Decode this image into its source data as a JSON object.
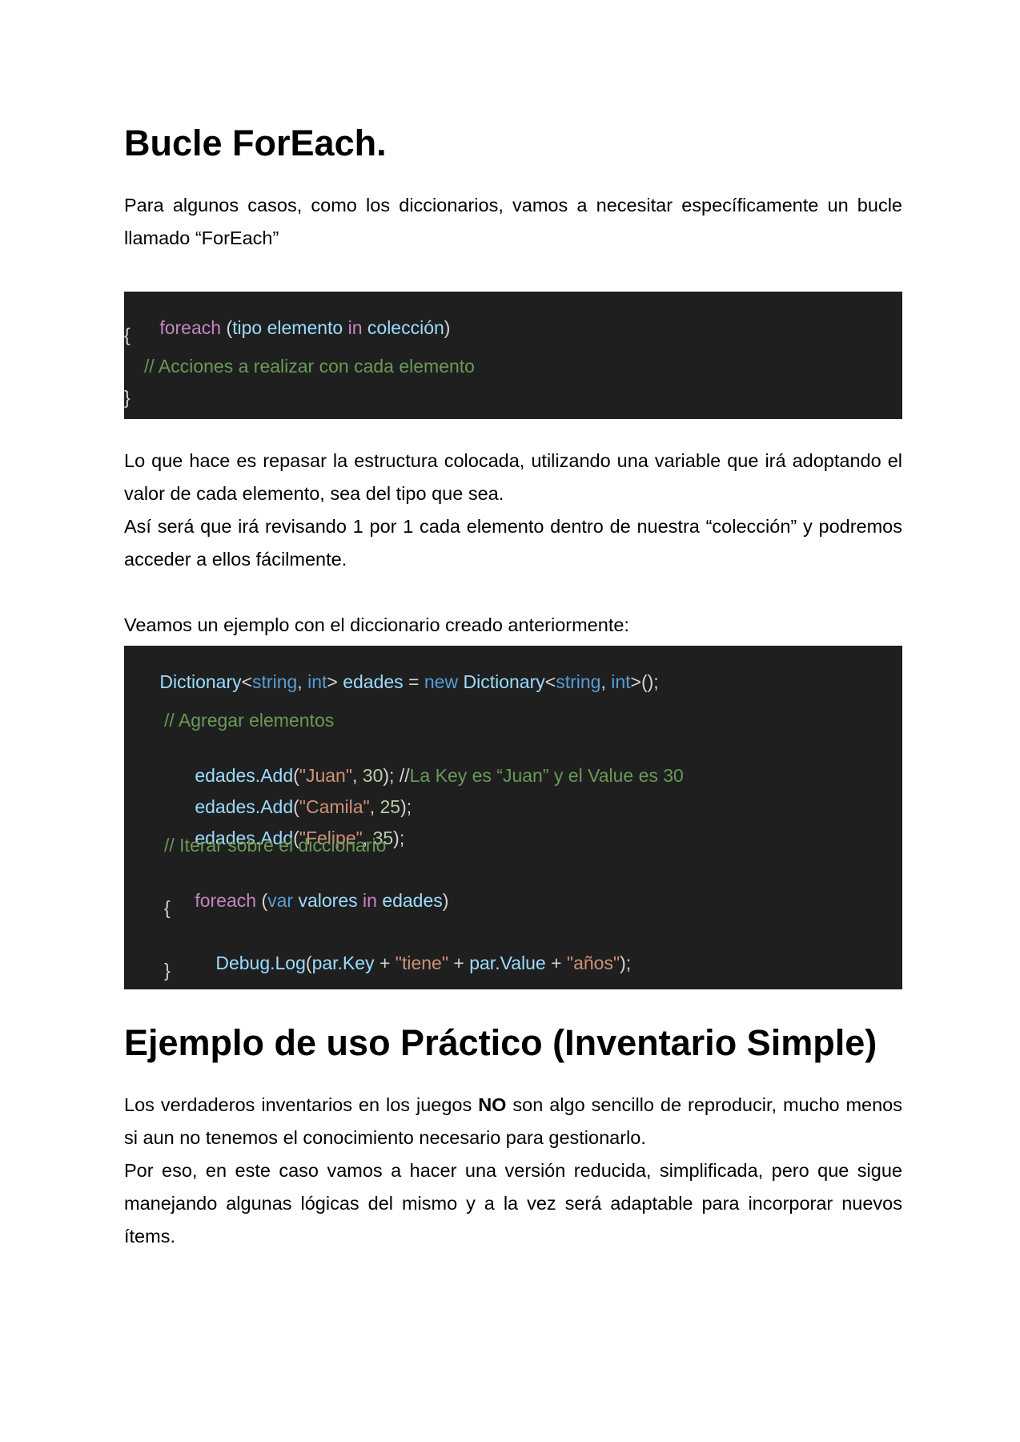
{
  "section1": {
    "heading": "Bucle ForEach.",
    "intro": "Para algunos casos, como los diccionarios, vamos a necesitar específicamente un bucle llamado “ForEach”",
    "code1": {
      "line1": {
        "t1": "foreach",
        "t2": " (",
        "t3": "tipo elemento",
        "t4": " in ",
        "t5": "colección",
        "t6": ")"
      },
      "line2": "{",
      "line3": "// Acciones a realizar con cada elemento",
      "line4": "}"
    },
    "explanation1": "Lo que hace es repasar la estructura colocada, utilizando una variable que irá adoptando el valor de cada elemento, sea del tipo que sea.",
    "explanation2": "Así será que irá revisando 1 por 1 cada elemento dentro de nuestra “colección” y podremos acceder a ellos fácilmente.",
    "example_intro": "Veamos un ejemplo con el diccionario creado anteriormente:",
    "code2": {
      "decl": {
        "a": "Dictionary",
        "b": "<",
        "c": "string",
        "d": ", ",
        "e": "int",
        "f": "> ",
        "g": "edades",
        "h": " = ",
        "i": "new",
        "j": " ",
        "k": "Dictionary",
        "l": "<",
        "m": "string",
        "n": ", ",
        "o": "int",
        "p": ">();"
      },
      "comment_add": "// Agregar elementos",
      "add1": {
        "a": "edades.Add",
        "b": "(",
        "c": "\"Juan\"",
        "d": ", ",
        "e": "30",
        "f": "); //",
        "g": "La Key es “Juan” y el Value es 30"
      },
      "add2": {
        "a": "edades.Add",
        "b": "(",
        "c": "\"Camila\"",
        "d": ", ",
        "e": "25",
        "f": ");"
      },
      "add3": {
        "a": "edades.Add",
        "b": "(",
        "c": "\"Felipe\"",
        "d": ", ",
        "e": "35",
        "f": ");"
      },
      "comment_iter": "// Iterar sobre el diccionario",
      "loop": {
        "a": "foreach",
        "b": " (",
        "c": "var",
        "d": " ",
        "e": "valores",
        "f": " in ",
        "g": "edades",
        "h": ")"
      },
      "open": "{",
      "log": {
        "a": "Debug.Log",
        "b": "(",
        "c": "par.Key",
        "d": " + ",
        "e": "\"tiene\"",
        "f": " + ",
        "g": "par.Value",
        "h": " + ",
        "i": "\"años\"",
        "j": ");"
      },
      "close": "}"
    }
  },
  "section2": {
    "heading": "Ejemplo de uso Práctico (Inventario Simple)",
    "para1_before": "Los verdaderos inventarios en los juegos ",
    "para1_bold": "NO",
    "para1_after": " son algo sencillo de reproducir, mucho menos si aun no tenemos el conocimiento necesario para gestionarlo.",
    "para2": "Por eso, en este caso vamos a hacer una versión reducida, simplificada, pero que sigue manejando algunas lógicas del mismo y a la vez será adaptable para incorporar nuevos ítems."
  },
  "colors": {
    "code_background": "#1f1f1f",
    "keyword": "#c586c0",
    "identifier": "#9cdcfe",
    "builtin_type": "#569cd6",
    "string": "#ce9178",
    "number": "#b5cea8",
    "comment": "#6a9955"
  }
}
